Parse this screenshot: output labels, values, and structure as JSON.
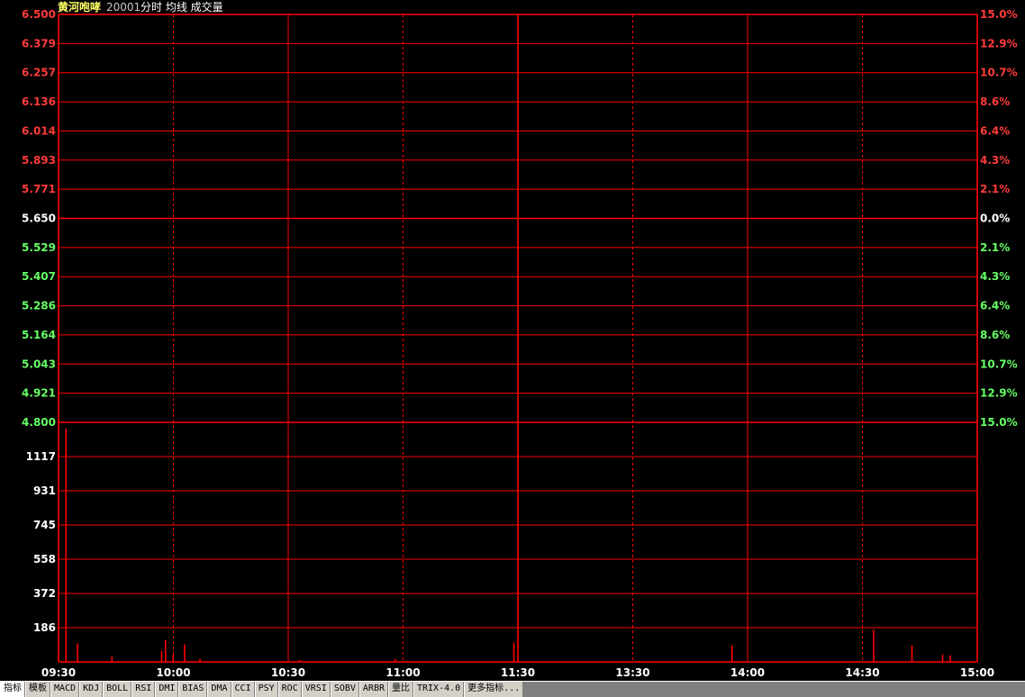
{
  "header": {
    "stock_name": "黄河咆哮",
    "stock_code": "20001",
    "indicators": "分时 均线 成交量"
  },
  "colors": {
    "grid": "#ff0000",
    "up": "#ff3b3b",
    "down": "#66ff66",
    "flat": "#ffffff",
    "volume": "#ff0000",
    "background": "#000000"
  },
  "chart_data": [
    {
      "type": "line",
      "title": "",
      "x": [
        "09:30",
        "10:00",
        "10:30",
        "11:00",
        "11:30",
        "13:30",
        "14:00",
        "14:30",
        "15:00"
      ],
      "y_ticks": [
        "6.500",
        "6.379",
        "6.257",
        "6.136",
        "6.014",
        "5.893",
        "5.771",
        "5.650",
        "5.529",
        "5.407",
        "5.286",
        "5.164",
        "5.043",
        "4.921",
        "4.800"
      ],
      "y2_ticks": [
        "15.0%",
        "12.9%",
        "10.7%",
        "8.6%",
        "6.4%",
        "4.3%",
        "2.1%",
        "0.0%",
        "2.1%",
        "4.3%",
        "6.4%",
        "8.6%",
        "10.7%",
        "12.9%",
        "15.0%"
      ],
      "ylim": [
        4.8,
        6.5
      ],
      "prev_close": 5.65,
      "grid": true,
      "series": []
    },
    {
      "type": "bar",
      "title": "",
      "x_range": [
        "09:30",
        "15:00"
      ],
      "y_ticks": [
        "1117",
        "931",
        "745",
        "558",
        "372",
        "186"
      ],
      "ylim": [
        0,
        1303
      ],
      "grid": true,
      "bars": [
        {
          "t": 1,
          "v": 1270
        },
        {
          "t": 4,
          "v": 100
        },
        {
          "t": 13,
          "v": 30
        },
        {
          "t": 26,
          "v": 60
        },
        {
          "t": 27,
          "v": 120
        },
        {
          "t": 29,
          "v": 40
        },
        {
          "t": 32,
          "v": 95
        },
        {
          "t": 36,
          "v": 15
        },
        {
          "t": 62,
          "v": 10
        },
        {
          "t": 87,
          "v": 15
        },
        {
          "t": 118,
          "v": 105
        },
        {
          "t": 175,
          "v": 90
        },
        {
          "t": 212,
          "v": 175
        },
        {
          "t": 222,
          "v": 90
        },
        {
          "t": 230,
          "v": 40
        },
        {
          "t": 232,
          "v": 35
        }
      ]
    }
  ],
  "tabs": [
    "指标",
    "模板",
    "MACD",
    "KDJ",
    "BOLL",
    "RSI",
    "DMI",
    "BIAS",
    "DMA",
    "CCI",
    "PSY",
    "ROC",
    "VRSI",
    "SOBV",
    "ARBR",
    "量比",
    "TRIX-4.0",
    "更多指标..."
  ]
}
